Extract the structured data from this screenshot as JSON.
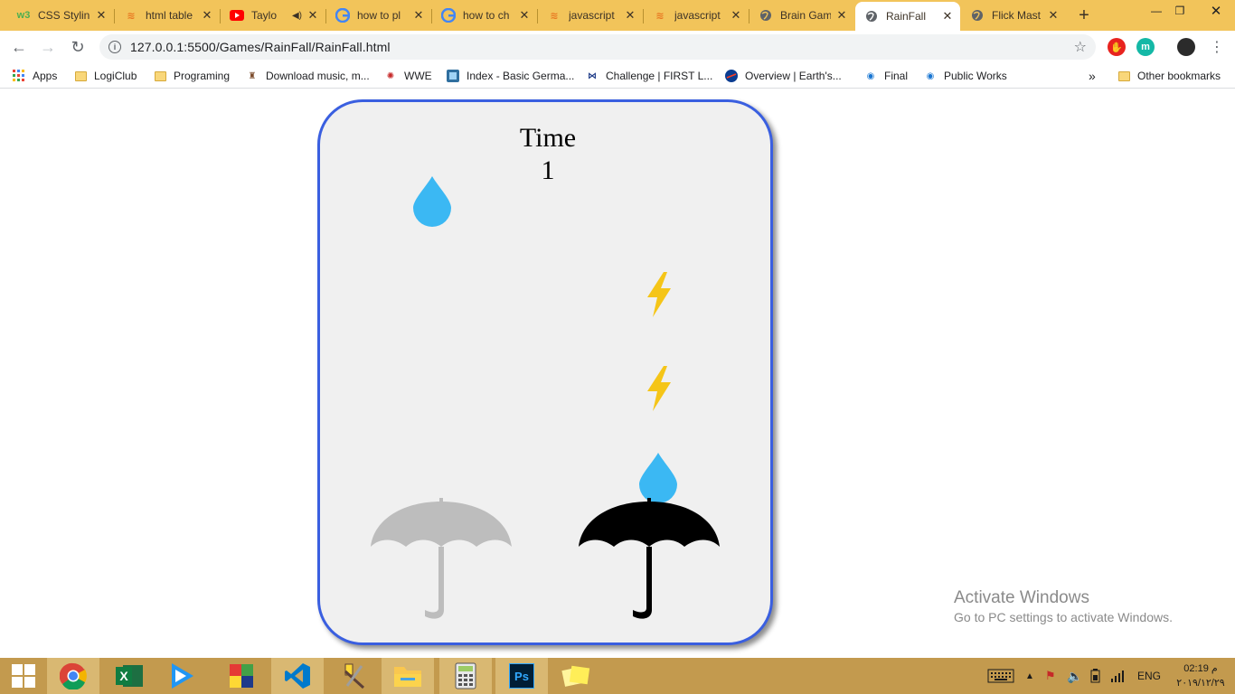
{
  "browser": {
    "tabs": [
      {
        "title": "CSS Stylin",
        "icon": "w3schools-icon"
      },
      {
        "title": "html table",
        "icon": "stackoverflow-icon"
      },
      {
        "title": "Taylo",
        "icon": "youtube-icon"
      },
      {
        "title": "how to pl",
        "icon": "google-icon"
      },
      {
        "title": "how to ch",
        "icon": "google-icon"
      },
      {
        "title": "javascript",
        "icon": "stackoverflow-icon"
      },
      {
        "title": "javascript",
        "icon": "stackoverflow-icon"
      },
      {
        "title": "Brain Gam",
        "icon": "globe-icon"
      },
      {
        "title": "RainFall",
        "icon": "globe-icon"
      },
      {
        "title": "Flick Mast",
        "icon": "globe-icon"
      }
    ],
    "active_tab": 8,
    "url": "127.0.0.1:5500/Games/RainFall/RainFall.html",
    "bookmarks": [
      {
        "label": "Apps"
      },
      {
        "label": "LogiClub"
      },
      {
        "label": "Programing"
      },
      {
        "label": "Download music, m..."
      },
      {
        "label": "WWE"
      },
      {
        "label": "Index - Basic Germa..."
      },
      {
        "label": "Challenge | FIRST L..."
      },
      {
        "label": "Overview | Earth's..."
      },
      {
        "label": "Final"
      },
      {
        "label": "Public Works"
      }
    ],
    "bookmarks_overflow": "»",
    "other_bookmarks": "Other bookmarks",
    "ext_avatar_letter": "m"
  },
  "game": {
    "time_label": "Time",
    "time_value": "1",
    "colors": {
      "board_border": "#3a5fe0",
      "board_bg": "#f0f0f0",
      "raindrop": "#3bb8f3",
      "lightning": "#f5c518",
      "umbrella_inactive": "#bdbdbd",
      "umbrella_active": "#000000"
    }
  },
  "watermark": {
    "title": "Activate Windows",
    "subtitle": "Go to PC settings to activate Windows."
  },
  "taskbar": {
    "apps": [
      "windows-start-icon",
      "chrome-icon",
      "excel-icon",
      "media-player-icon",
      "winrar-icon",
      "vscode-icon",
      "tools-icon",
      "file-explorer-icon",
      "calculator-icon",
      "photoshop-icon",
      "sticky-notes-icon"
    ],
    "language": "ENG",
    "clock_time": "02:19 م",
    "clock_date": "٢٠١٩/١٢/٢٩"
  }
}
